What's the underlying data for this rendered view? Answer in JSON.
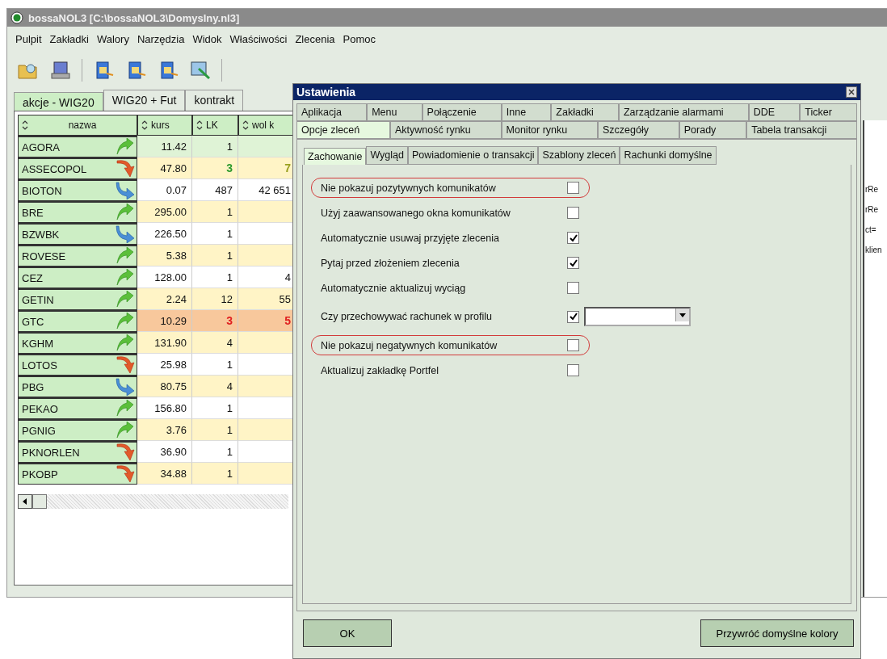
{
  "main_window": {
    "title": "bossaNOL3 [C:\\bossaNOL3\\Domyslny.nl3]",
    "menu": [
      "Pulpit",
      "Zakładki",
      "Walory",
      "Narzędzia",
      "Widok",
      "Właściwości",
      "Zlecenia",
      "Pomoc"
    ],
    "tabs": [
      {
        "label": "akcje - WIG20",
        "selected": true
      },
      {
        "label": "WIG20 + Fut",
        "selected": false
      },
      {
        "label": "kontrakt",
        "selected": false
      }
    ],
    "table": {
      "columns": [
        "nazwa",
        "kurs",
        "LK",
        "wol k"
      ],
      "rows": [
        {
          "name": "AGORA",
          "kind": "up",
          "kurs": "11.42",
          "lk": {
            "text": "1"
          },
          "color": "#dff3d6"
        },
        {
          "name": "ASSECOPOL",
          "kind": "down",
          "kurs": "47.80",
          "lk": {
            "text": "3",
            "color": "#2e9a2e"
          },
          "wol": {
            "text": "7",
            "color": "#9aa020"
          },
          "color": "#fff4c6"
        },
        {
          "name": "BIOTON",
          "kind": "side",
          "kurs": "0.07",
          "lk": {
            "text": "487"
          },
          "wol": {
            "text": "42 651"
          },
          "color": "#ffffff"
        },
        {
          "name": "BRE",
          "kind": "up",
          "kurs": "295.00",
          "lk": {
            "text": "1"
          },
          "color": "#fff4c6"
        },
        {
          "name": "BZWBK",
          "kind": "side",
          "kurs": "226.50",
          "lk": {
            "text": "1"
          },
          "color": "#ffffff"
        },
        {
          "name": "ROVESE",
          "kind": "up",
          "kurs": "5.38",
          "lk": {
            "text": "1"
          },
          "color": "#fff4c6"
        },
        {
          "name": "CEZ",
          "kind": "up",
          "kurs": "128.00",
          "lk": {
            "text": "1"
          },
          "wol": {
            "text": "4"
          },
          "color": "#ffffff"
        },
        {
          "name": "GETIN",
          "kind": "up",
          "kurs": "2.24",
          "lk": {
            "text": "12"
          },
          "wol": {
            "text": "55"
          },
          "color": "#fff4c6"
        },
        {
          "name": "GTC",
          "kind": "up",
          "kurs": "10.29",
          "lk": {
            "text": "3",
            "color": "#e02020"
          },
          "wol": {
            "text": "5",
            "color": "#e02020"
          },
          "color": "#f8c89c"
        },
        {
          "name": "KGHM",
          "kind": "up",
          "kurs": "131.90",
          "lk": {
            "text": "4"
          },
          "color": "#fff4c6"
        },
        {
          "name": "LOTOS",
          "kind": "down",
          "kurs": "25.98",
          "lk": {
            "text": "1"
          },
          "color": "#ffffff"
        },
        {
          "name": "PBG",
          "kind": "side",
          "kurs": "80.75",
          "lk": {
            "text": "4"
          },
          "color": "#fff4c6"
        },
        {
          "name": "PEKAO",
          "kind": "up",
          "kurs": "156.80",
          "lk": {
            "text": "1"
          },
          "color": "#ffffff"
        },
        {
          "name": "PGNIG",
          "kind": "up",
          "kurs": "3.76",
          "lk": {
            "text": "1"
          },
          "color": "#fff4c6"
        },
        {
          "name": "PKNORLEN",
          "kind": "down",
          "kurs": "36.90",
          "lk": {
            "text": "1"
          },
          "color": "#ffffff"
        },
        {
          "name": "PKOBP",
          "kind": "down",
          "kurs": "34.88",
          "lk": {
            "text": "1"
          },
          "color": "#fff4c6"
        }
      ]
    },
    "right_panel": [
      "rRe",
      "rRe",
      "ct=",
      "klien"
    ]
  },
  "dialog": {
    "title": "Ustawienia",
    "tab_rows": [
      [
        {
          "label": "Aplikacja",
          "selected": false
        },
        {
          "label": "Menu",
          "selected": false
        },
        {
          "label": "Połączenie",
          "selected": false
        },
        {
          "label": "Inne",
          "selected": false
        },
        {
          "label": "Zakładki",
          "selected": false
        },
        {
          "label": "Zarządzanie alarmami",
          "selected": false
        },
        {
          "label": "DDE",
          "selected": false
        },
        {
          "label": "Ticker",
          "selected": false
        }
      ],
      [
        {
          "label": "Opcje zleceń",
          "selected": true
        },
        {
          "label": "Aktywność rynku",
          "selected": false
        },
        {
          "label": "Monitor rynku",
          "selected": false
        },
        {
          "label": "Szczegóły",
          "selected": false
        },
        {
          "label": "Porady",
          "selected": false
        },
        {
          "label": "Tabela transakcji",
          "selected": false
        }
      ]
    ],
    "subtabs": [
      {
        "label": "Zachowanie",
        "selected": true
      },
      {
        "label": "Wygląd",
        "selected": false
      },
      {
        "label": "Powiadomienie o transakcji",
        "selected": false
      },
      {
        "label": "Szablony zleceń",
        "selected": false
      },
      {
        "label": "Rachunki domyślne",
        "selected": false
      }
    ],
    "options": [
      {
        "kind": "checkbox",
        "label": "Nie pokazuj pozytywnych komunikatów",
        "checked": false,
        "highlighted": true
      },
      {
        "kind": "checkbox",
        "label": "Użyj zaawansowanego okna komunikatów",
        "checked": false,
        "highlighted": false
      },
      {
        "kind": "checkbox",
        "label": "Automatycznie usuwaj przyjęte zlecenia",
        "checked": true,
        "highlighted": false
      },
      {
        "kind": "checkbox",
        "label": "Pytaj przed złożeniem zlecenia",
        "checked": true,
        "highlighted": false
      },
      {
        "kind": "checkbox",
        "label": "Automatycznie aktualizuj wyciąg",
        "checked": false,
        "highlighted": false
      },
      {
        "kind": "checkbox_select",
        "label": "Czy przechowywać rachunek w profilu",
        "checked": true,
        "highlighted": false
      },
      {
        "kind": "checkbox",
        "label": "Nie pokazuj negatywnych komunikatów",
        "checked": false,
        "highlighted": true
      },
      {
        "kind": "checkbox",
        "label": "Aktualizuj zakładkę Portfel",
        "checked": false,
        "highlighted": false
      }
    ],
    "buttons": [
      "OK",
      "Przywróć domyślne kolory"
    ]
  }
}
